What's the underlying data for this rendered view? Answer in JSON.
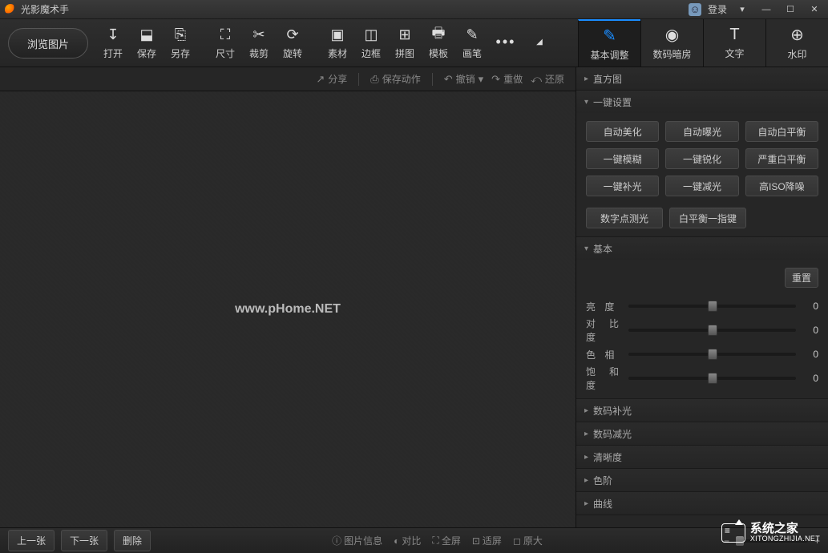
{
  "title": "光影魔术手",
  "login": "登录",
  "browse": "浏览图片",
  "toolbar": [
    {
      "icon": "↧",
      "label": "打开",
      "name": "open"
    },
    {
      "icon": "⬓",
      "label": "保存",
      "name": "save"
    },
    {
      "icon": "⎘",
      "label": "另存",
      "name": "save-as"
    },
    {
      "sep": true
    },
    {
      "icon": "⛶",
      "label": "尺寸",
      "name": "size"
    },
    {
      "icon": "✂",
      "label": "裁剪",
      "name": "crop"
    },
    {
      "icon": "⟳",
      "label": "旋转",
      "name": "rotate"
    },
    {
      "sep": true
    },
    {
      "icon": "▣",
      "label": "素材",
      "name": "material"
    },
    {
      "icon": "◫",
      "label": "边框",
      "name": "border"
    },
    {
      "icon": "⊞",
      "label": "拼图",
      "name": "collage"
    },
    {
      "icon": "🖶",
      "label": "模板",
      "name": "template"
    },
    {
      "icon": "✎",
      "label": "画笔",
      "name": "brush"
    },
    {
      "icon": "•••",
      "label": "",
      "name": "more",
      "more": true
    }
  ],
  "rightTabs": [
    {
      "icon": "✎",
      "label": "基本调整",
      "name": "basic-adjust",
      "active": true
    },
    {
      "icon": "◉",
      "label": "数码暗房",
      "name": "darkroom"
    },
    {
      "icon": "T",
      "label": "文字",
      "name": "text"
    },
    {
      "icon": "⊕",
      "label": "水印",
      "name": "watermark"
    }
  ],
  "actionBar": {
    "share": "分享",
    "saveAction": "保存动作",
    "undo": "撤销",
    "redo": "重做",
    "restore": "还原"
  },
  "canvasText": "www.pHome.NET",
  "panel": {
    "histogram": "直方图",
    "oneClick": {
      "title": "一键设置",
      "buttons": [
        "自动美化",
        "自动曝光",
        "自动白平衡",
        "一键模糊",
        "一键锐化",
        "严重白平衡",
        "一键补光",
        "一键减光",
        "高ISO降噪"
      ],
      "buttons2": [
        "数字点测光",
        "白平衡一指键"
      ]
    },
    "basic": {
      "title": "基本",
      "reset": "重置",
      "sliders": [
        {
          "label": "亮  度",
          "value": 0
        },
        {
          "label": "对 比 度",
          "value": 0
        },
        {
          "label": "色  相",
          "value": 0
        },
        {
          "label": "饱 和 度",
          "value": 0
        }
      ]
    },
    "collapsed": [
      "数码补光",
      "数码减光",
      "清晰度",
      "色阶",
      "曲线"
    ]
  },
  "footer": {
    "prev": "上一张",
    "next": "下一张",
    "delete": "删除",
    "info": "图片信息",
    "compare": "对比",
    "fullscreen": "全屏",
    "fit": "适屏",
    "original": "原大"
  },
  "brand": {
    "name": "系统之家",
    "url": "XITONGZHIJIA.NET"
  }
}
